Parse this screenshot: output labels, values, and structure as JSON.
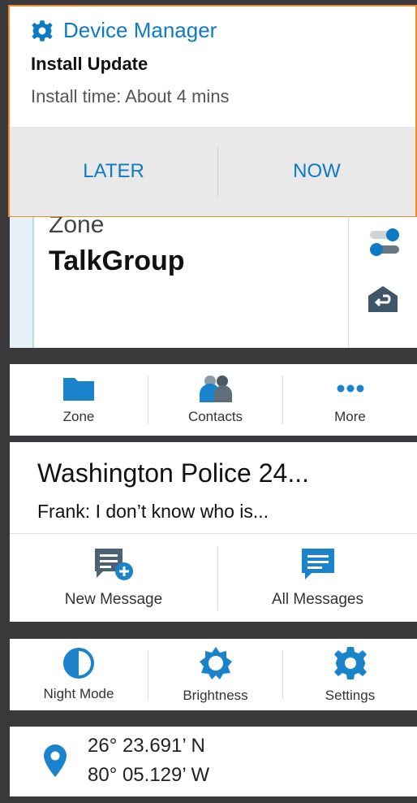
{
  "notification": {
    "app_name": "Device Manager",
    "title": "Install Update",
    "text": "Install time: About 4 mins",
    "later_label": "LATER",
    "now_label": "NOW"
  },
  "zone": {
    "label": "Zone",
    "name": "TalkGroup"
  },
  "quick_actions": [
    {
      "label": "Zone"
    },
    {
      "label": "Contacts"
    },
    {
      "label": "More"
    }
  ],
  "messages": {
    "title": "Washington Police 24...",
    "preview": "Frank: I don’t know who is...",
    "new_label": "New Message",
    "all_label": "All Messages"
  },
  "display": [
    {
      "label": "Night Mode"
    },
    {
      "label": "Brightness"
    },
    {
      "label": "Settings"
    }
  ],
  "location": {
    "lat": "26° 23.691’ N",
    "lon": "80° 05.129’ W"
  },
  "colors": {
    "accent": "#0d7bc4",
    "notification_border": "#ef8a2e",
    "background": "#3a3a3c"
  }
}
